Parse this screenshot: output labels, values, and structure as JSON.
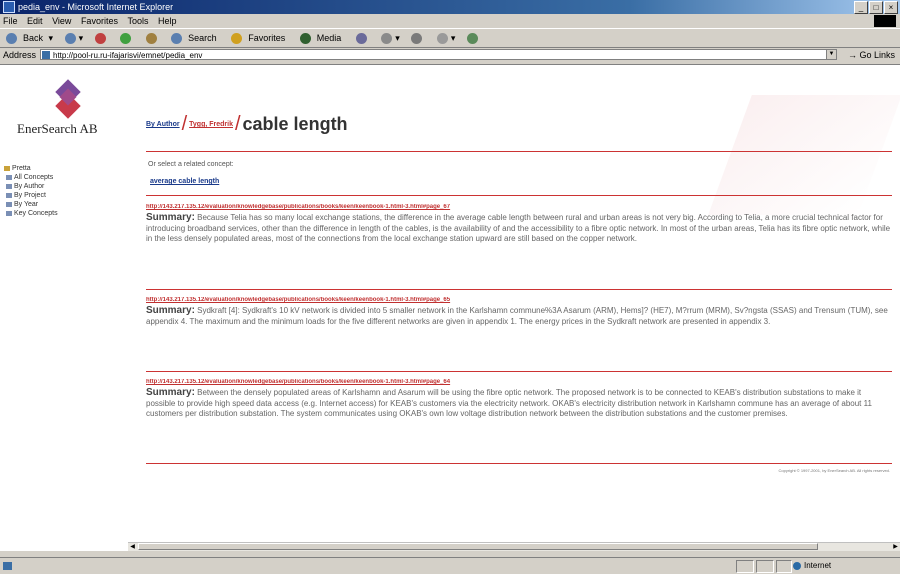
{
  "window": {
    "title": "pedia_env - Microsoft Internet Explorer"
  },
  "menu": [
    "File",
    "Edit",
    "View",
    "Favorites",
    "Tools",
    "Help"
  ],
  "toolbar": {
    "back": "Back",
    "search": "Search",
    "favorites": "Favorites",
    "media": "Media"
  },
  "address": {
    "label": "Address",
    "url": "http://pool-ru.ru-ifajarisvi/emnet/pedia_env",
    "go": "Go",
    "links": "Links"
  },
  "sidebar": {
    "company": "EnerSearch AB",
    "tree_root": "Pretta",
    "items": [
      "All Concepts",
      "By Author",
      "By Project",
      "By Year",
      "Key Concepts"
    ]
  },
  "breadcrumb": {
    "author_link": "By Author",
    "name_link": "Tygg, Fredrik",
    "title": "cable length"
  },
  "hint": "Or select a related concept:",
  "related_concept": "average cable length",
  "results": [
    {
      "url": "http://143.217.135.12/evaluation/knowledgebase/publications/books/keen/keenbook-1.html-3.html#page_67",
      "summary_label": "Summary:",
      "summary": "Because Telia has so many local exchange stations, the difference in the average cable length between rural and urban areas is not very big. According to Telia, a more crucial technical factor for introducing broadband services, other than the difference in length of the cables, is the availability of and the accessibility to a fibre optic network. In most of the urban areas, Telia has its fibre optic network, while in the less densely populated areas, most of the connections from the local exchange station upward are still based on the copper network."
    },
    {
      "url": "http://143.217.135.12/evaluation/knowledgebase/publications/books/keen/keenbook-1.html-3.html#page_65",
      "summary_label": "Summary:",
      "summary": "Sydkraft [4]: Sydkraft's 10 kV network is divided into 5 smaller network in the Karlshamn commune%3A Asarum (ARM), Hems]? (HE7), M?rrum (MRM), Sv?ngsta (SSAS) and Trensum (TUM), see appendix 4. The maximum and the minimum loads for the five different networks are given in appendix 1. The energy prices in the Sydkraft network are presented in appendix 3."
    },
    {
      "url": "http://143.217.135.12/evaluation/knowledgebase/publications/books/keen/keenbook-1.html-3.html#page_64",
      "summary_label": "Summary:",
      "summary": "Between the densely populated areas of Karlshamn and Asarum will be using the fibre optic network. The proposed network is to be connected to KEAB's distribution substations to make it possible to provide high speed data access (e.g. Internet access) for KEAB's customers via the electricity network. OKAB's electricity distribution network in Karlshamn commune has an average of about 11 customers per distribution substation. The system communicates using OKAB's own low voltage distribution network between the distribution substations and the customer premises."
    }
  ],
  "copyright": "Copyright © 1997-2001, by EnerSearch AB. All rights reserved.",
  "status": {
    "zone": "Internet"
  },
  "colors": {
    "accent_red": "#cc3333",
    "link_blue": "#1a3a8a"
  }
}
